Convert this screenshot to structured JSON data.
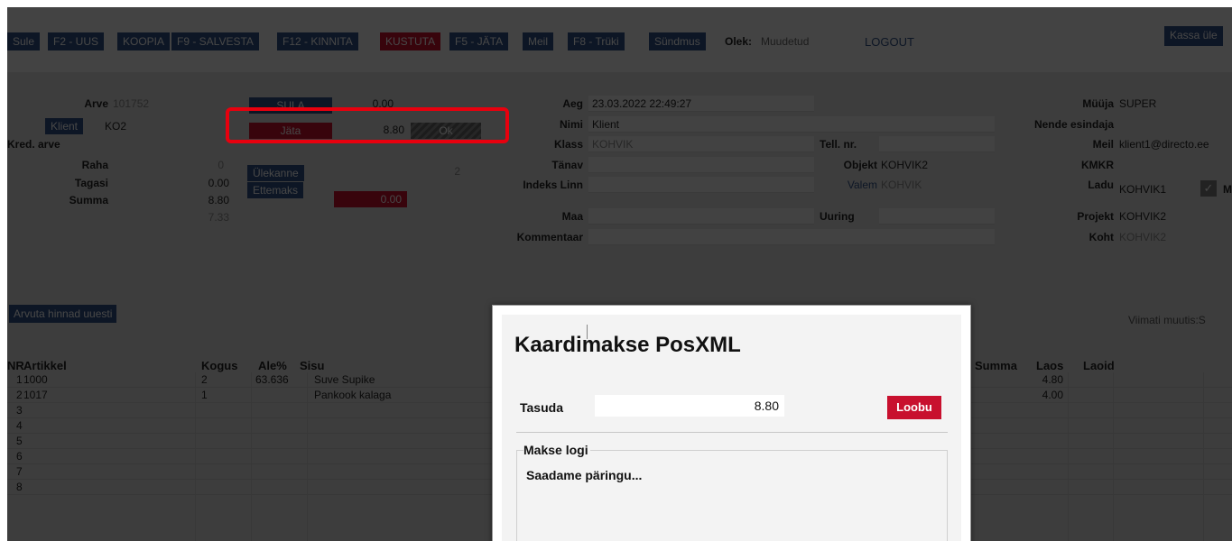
{
  "toolbar": {
    "buttons": [
      {
        "label": "Sule",
        "color": "#315084"
      },
      {
        "label": "F2 - UUS",
        "color": "#315084"
      },
      {
        "label": "KOOPIA",
        "color": "#315084"
      },
      {
        "label": "F9 - SALVESTA",
        "color": "#315084"
      },
      {
        "label": "F12 - KINNITA",
        "color": "#315084"
      },
      {
        "label": "KUSTUTA",
        "color": "#c8102e"
      },
      {
        "label": "F5 - JÄTA",
        "color": "#315084"
      },
      {
        "label": "Meil",
        "color": "#315084"
      },
      {
        "label": "F8 - Trüki",
        "color": "#315084"
      },
      {
        "label": "Sündmus",
        "color": "#315084"
      }
    ],
    "olek_label": "Olek:",
    "olek_value": "Muudetud",
    "logout": "LOGOUT",
    "kassa": "Kassa üle"
  },
  "form": {
    "arve_label": "Arve",
    "arve_value": "101752",
    "klient_button": "Klient",
    "klient_value": "KO2",
    "kred_arve_label": "Kred. arve",
    "raha_label": "Raha",
    "raha_value": "0",
    "tagasi_label": "Tagasi",
    "tagasi_value": "0.00",
    "summa_label": "Summa",
    "summa_value": "8.80",
    "summa_net": "7.33",
    "sula_button": "SULA",
    "sula_value": "0.00",
    "jata_button": "Jäta",
    "jata_value": "8.80",
    "ok_button": "Ok",
    "ulekanne_button": "Ülekanne",
    "ulekanne_value": "2",
    "ettemaks_button": "Ettemaks",
    "ettemaks_value": "0.00",
    "aeg_label": "Aeg",
    "aeg_value": "23.03.2022 22:49:27",
    "nimi_label": "Nimi",
    "nimi_value": "Klient",
    "klass_label": "Klass",
    "klass_value": "KOHVIK",
    "tanav_label": "Tänav",
    "indeks_linn_label": "Indeks Linn",
    "maa_label": "Maa",
    "kommentaar_label": "Kommentaar",
    "tell_nr_label": "Tell. nr.",
    "objekt_label": "Objekt",
    "objekt_value": "KOHVIK2",
    "valem_label": "Valem",
    "valem_value": "KOHVIK",
    "uuring_label": "Uuring",
    "muuja_label": "Müüja",
    "muuja_value": "SUPER",
    "nende_esindaja_label": "Nende esindaja",
    "meil_label": "Meil",
    "meil_value": "klient1@directo.ee",
    "kmkr_label": "KMKR",
    "ladu_label": "Ladu",
    "ladu_value": "KOHVIK1",
    "ladu_check": "✓",
    "ladu_check_suffix": "M",
    "projekt_label": "Projekt",
    "projekt_value": "KOHVIK2",
    "koht_label": "Koht",
    "koht_value": "KOHVIK2"
  },
  "recalc_button": "Arvuta hinnad uuesti",
  "viimati_muutis": "Viimati muutis:S",
  "table": {
    "headers": {
      "nr": "NR",
      "artikkel": "Artikkel",
      "kogus": "Kogus",
      "ale": "Ale%",
      "sisu": "Sisu",
      "summa": "Summa",
      "laos": "Laos",
      "laoid": "Laoid"
    },
    "rows": [
      {
        "nr": "1",
        "artikkel": "1000",
        "kogus": "2",
        "ale": "63.636",
        "sisu": "Suve Supike",
        "summa": "4.80"
      },
      {
        "nr": "2",
        "artikkel": "1017",
        "kogus": "1",
        "ale": "",
        "sisu": "Pankook kalaga",
        "summa": "4.00"
      },
      {
        "nr": "3"
      },
      {
        "nr": "4"
      },
      {
        "nr": "5"
      },
      {
        "nr": "6"
      },
      {
        "nr": "7"
      },
      {
        "nr": "8"
      }
    ]
  },
  "modal": {
    "title": "Kaardimakse PosXML",
    "tasuda_label": "Tasuda",
    "tasuda_value": "8.80",
    "loobu_button": "Loobu",
    "log_legend": "Makse logi",
    "log_text": "Saadame päringu..."
  },
  "colors": {
    "accent": "#315084",
    "danger": "#c8102e",
    "highlight": "#e8000e"
  }
}
